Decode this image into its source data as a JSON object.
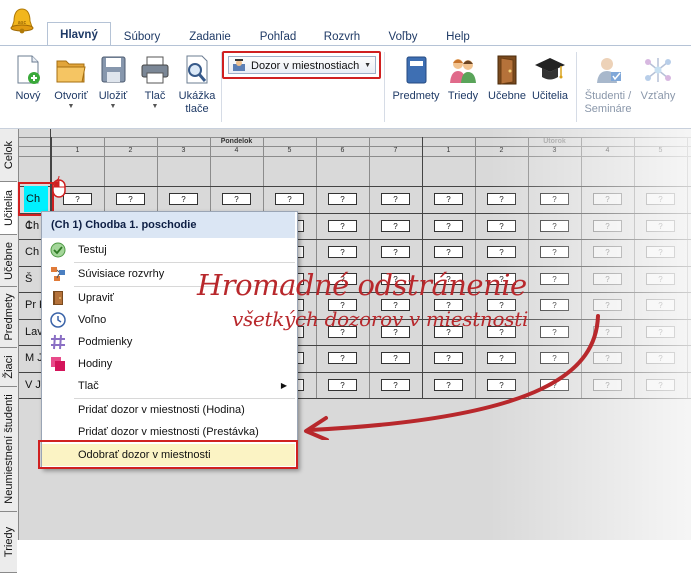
{
  "ribbon": {
    "tabs": [
      "Hlavný",
      "Súbory",
      "Zadanie",
      "Pohľad",
      "Rozvrh",
      "Voľby",
      "Help"
    ],
    "active_tab": "Hlavný",
    "buttons": {
      "new": "Nový",
      "open": "Otvoriť",
      "save": "Uložiť",
      "print": "Tlač",
      "preview_line1": "Ukážka",
      "preview_line2": "tlače",
      "subjects": "Predmety",
      "classes": "Triedy",
      "rooms": "Učebne",
      "teachers": "Učitelia",
      "students_line1": "Študenti /",
      "students_line2": "Semináre",
      "relations": "Vzťahy"
    },
    "view_select": "Dozor v miestnostiach"
  },
  "left_tabs": [
    "Celok",
    "Učitelia",
    "Učebne",
    "Predmety",
    "Žiaci",
    "Neumiestnení študenti",
    "Triedy"
  ],
  "grid": {
    "days": [
      {
        "name": "Pondelok",
        "periods": [
          "1",
          "2",
          "3",
          "4",
          "5",
          "6",
          "7"
        ]
      },
      {
        "name": "Utorok",
        "periods": [
          "1",
          "2",
          "3",
          "4",
          "5"
        ]
      }
    ],
    "rows": [
      {
        "label": "Ch 1",
        "selected": true
      },
      {
        "label": "Ch"
      },
      {
        "label": "Ch 2"
      },
      {
        "label": "Š"
      },
      {
        "label": "Pr K"
      },
      {
        "label": "Lav"
      },
      {
        "label": "M J"
      },
      {
        "label": "V J"
      }
    ],
    "cell_mark": "?"
  },
  "context_menu": {
    "header": "(Ch 1) Chodba 1. poschodie",
    "items": {
      "test": "Testuj",
      "related": "Súvisiace rozvrhy",
      "edit": "Upraviť",
      "free": "Voľno",
      "conditions": "Podmienky",
      "hours": "Hodiny",
      "print": "Tlač",
      "add_lesson": "Pridať dozor v miestnosti (Hodina)",
      "add_break": "Pridať dozor v miestnosti (Prestávka)",
      "remove": "Odobrať dozor v miestnosti"
    }
  },
  "annotation": {
    "title": "Hromadné odstránenie",
    "subtitle": "všetkých dozorov v miestnosti"
  }
}
